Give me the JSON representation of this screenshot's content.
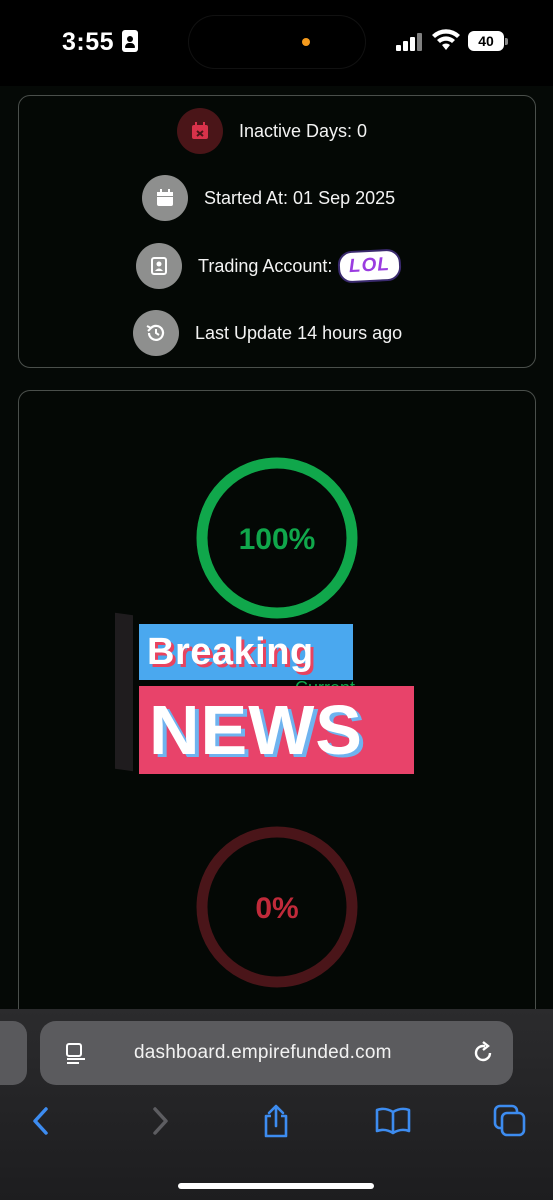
{
  "status_bar": {
    "time": "3:55",
    "battery": "40"
  },
  "info": {
    "inactive_days": "Inactive Days: 0",
    "started_at": "Started At: 01 Sep 2025",
    "trading_account": "Trading Account:",
    "trading_account_sticker": "LOL",
    "last_update": "Last Update 14 hours ago"
  },
  "progress": {
    "top_ring": {
      "label": "100%",
      "value": 1.0,
      "color": "#10a74b"
    },
    "bottom_ring": {
      "label": "0%",
      "value": 0.0,
      "color": "#c02a3a"
    },
    "partial_label": "Current"
  },
  "sticker": {
    "breaking": "Breaking",
    "news": "NEWS"
  },
  "browser": {
    "url": "dashboard.empirefunded.com"
  },
  "icons": {
    "inactive": "calendar-x-icon",
    "started": "calendar-icon",
    "account": "contact-card-icon",
    "update": "history-icon"
  },
  "colors": {
    "accent_green": "#10a74b",
    "accent_red": "#c02a3a",
    "ios_blue": "#3d8cf0"
  }
}
